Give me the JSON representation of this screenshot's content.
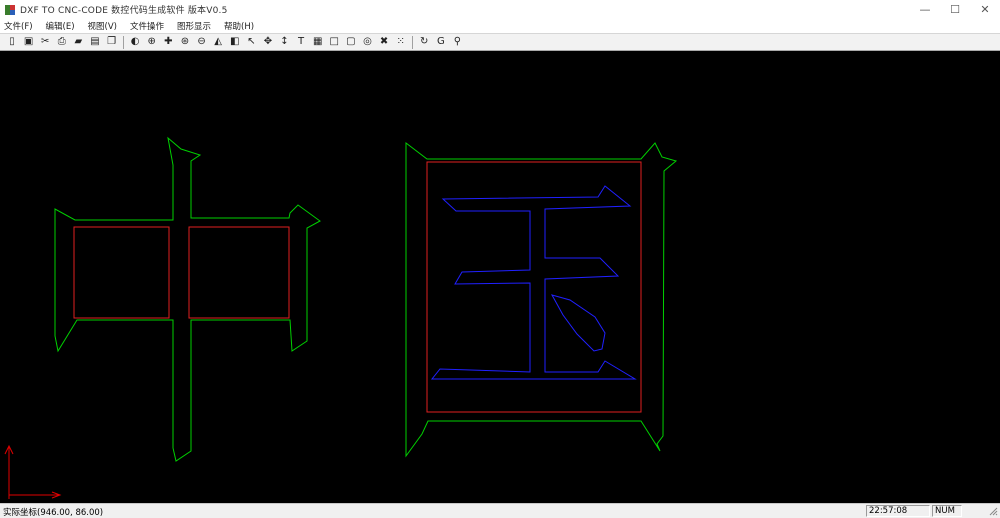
{
  "window": {
    "title": "DXF TO CNC-CODE 数控代码生成软件 版本V0.5",
    "minimize_glyph": "—",
    "maximize_glyph": "☐",
    "close_glyph": "✕"
  },
  "menu": [
    {
      "label": "文件(F)"
    },
    {
      "label": "编辑(E)"
    },
    {
      "label": "视图(V)"
    },
    {
      "label": "文件操作"
    },
    {
      "label": "图形显示"
    },
    {
      "label": "帮助(H)"
    }
  ],
  "toolbar": [
    {
      "name": "new-file-icon",
      "glyph": "▯"
    },
    {
      "name": "save-icon",
      "glyph": "▣"
    },
    {
      "name": "cut-icon",
      "glyph": "✂"
    },
    {
      "name": "print-icon",
      "glyph": "⎙"
    },
    {
      "name": "open-folder-icon",
      "glyph": "▰"
    },
    {
      "name": "export-icon",
      "glyph": "▤"
    },
    {
      "name": "copy-icon",
      "glyph": "❐"
    },
    "sep",
    {
      "name": "zoom-window-icon",
      "glyph": "◐"
    },
    {
      "name": "zoom-icon",
      "glyph": "⊕"
    },
    {
      "name": "pan-icon",
      "glyph": "✚"
    },
    {
      "name": "zoom-in-icon",
      "glyph": "⊛"
    },
    {
      "name": "zoom-out-icon",
      "glyph": "⊖"
    },
    {
      "name": "rotate-icon",
      "glyph": "◭"
    },
    {
      "name": "mirror-icon",
      "glyph": "◧"
    },
    {
      "name": "select-arrow-icon",
      "glyph": "↖"
    },
    {
      "name": "move-icon",
      "glyph": "✥"
    },
    {
      "name": "vertical-move-icon",
      "glyph": "↕"
    },
    {
      "name": "text-icon",
      "glyph": "T"
    },
    {
      "name": "grid-icon",
      "glyph": "▦"
    },
    {
      "name": "rectangle-icon",
      "glyph": "□"
    },
    {
      "name": "frame-icon",
      "glyph": "▢"
    },
    {
      "name": "circle-icon",
      "glyph": "◎"
    },
    {
      "name": "delete-icon",
      "glyph": "✖"
    },
    {
      "name": "select-all-icon",
      "glyph": "⁙"
    },
    "sep",
    {
      "name": "refresh-icon",
      "glyph": "↻"
    },
    {
      "name": "generate-code-icon",
      "glyph": "G"
    },
    {
      "name": "help-icon",
      "glyph": "⚲"
    }
  ],
  "status": {
    "coords": "实际坐标(946.00, 86.00)",
    "time": "22:57:08",
    "num": "NUM"
  },
  "colors": {
    "canvas_bg": "#000000",
    "outer_contour": "#00d000",
    "inner_contour": "#e02020",
    "character_path": "#2020ff",
    "axis": "#e00000"
  }
}
